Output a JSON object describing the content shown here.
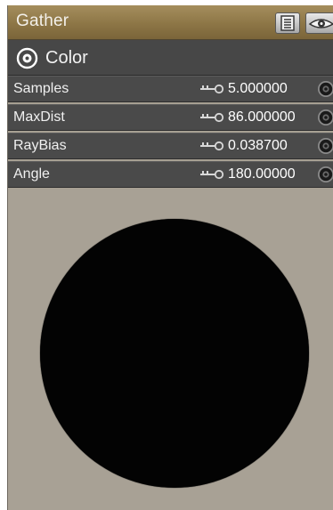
{
  "panel": {
    "title": "Gather",
    "menu_icon": "list-menu-icon",
    "visibility_icon": "eye-icon"
  },
  "section": {
    "icon": "target-circle-icon",
    "label": "Color"
  },
  "params": [
    {
      "name": "Samples",
      "value": "5.000000",
      "icon": "key-icon"
    },
    {
      "name": "MaxDist",
      "value": "86.000000",
      "icon": "key-icon"
    },
    {
      "name": "RayBias",
      "value": "0.038700",
      "icon": "key-icon"
    },
    {
      "name": "Angle",
      "value": "180.00000",
      "icon": "key-icon"
    }
  ],
  "preview": {
    "swatch_color": "#030303",
    "background_color": "#a8a195"
  }
}
